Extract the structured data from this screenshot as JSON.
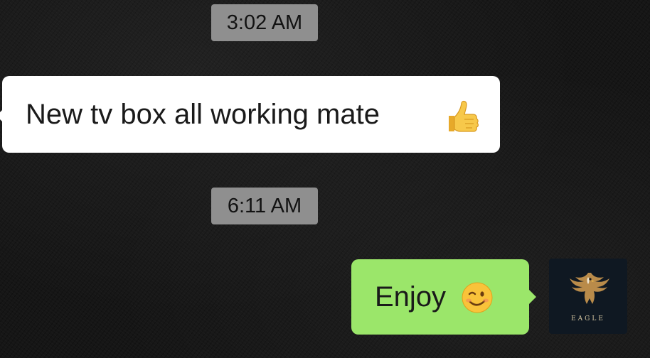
{
  "chat": {
    "messages": [
      {
        "time": "3:02 AM",
        "direction": "incoming",
        "text": "New tv box all working mate",
        "emoji": "thumbs-up"
      },
      {
        "time": "6:11 AM",
        "direction": "outgoing",
        "text": "Enjoy",
        "emoji": "winking-face"
      }
    ],
    "avatar_caption": "EAGLE"
  },
  "colors": {
    "incoming_bubble": "#ffffff",
    "outgoing_bubble": "#9be66a",
    "timestamp_chip": "#8f8f8f",
    "wallpaper": "#161616"
  }
}
